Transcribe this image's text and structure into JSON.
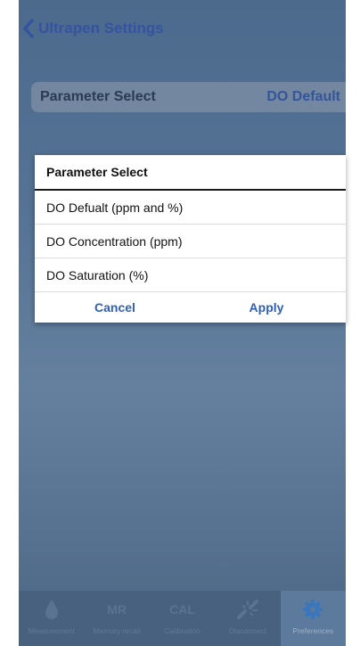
{
  "navbar": {
    "back_label": "Ultrapen Settings"
  },
  "settings": {
    "param_label": "Parameter Select",
    "param_value": "DO Default"
  },
  "dialog": {
    "title": "Parameter Select",
    "options": [
      "DO Defualt (ppm and %)",
      "DO Concentration (ppm)",
      "DO Saturation (%)"
    ],
    "cancel": "Cancel",
    "apply": "Apply"
  },
  "tabs": [
    {
      "label": "Measurement",
      "icon": "drop-icon",
      "glyph": ""
    },
    {
      "label": "Memory recall",
      "icon": "mr-icon",
      "glyph": "MR"
    },
    {
      "label": "Calibration",
      "icon": "cal-icon",
      "glyph": "CAL"
    },
    {
      "label": "Disconnect",
      "icon": "disconnect-icon",
      "glyph": ""
    },
    {
      "label": "Preferences",
      "icon": "gear-icon",
      "glyph": ""
    }
  ],
  "colors": {
    "accent": "#3d66c4",
    "dialog_button": "#2d5fb8",
    "tabbar": "#4f6c8a",
    "active_icon": "#3f86d8"
  }
}
